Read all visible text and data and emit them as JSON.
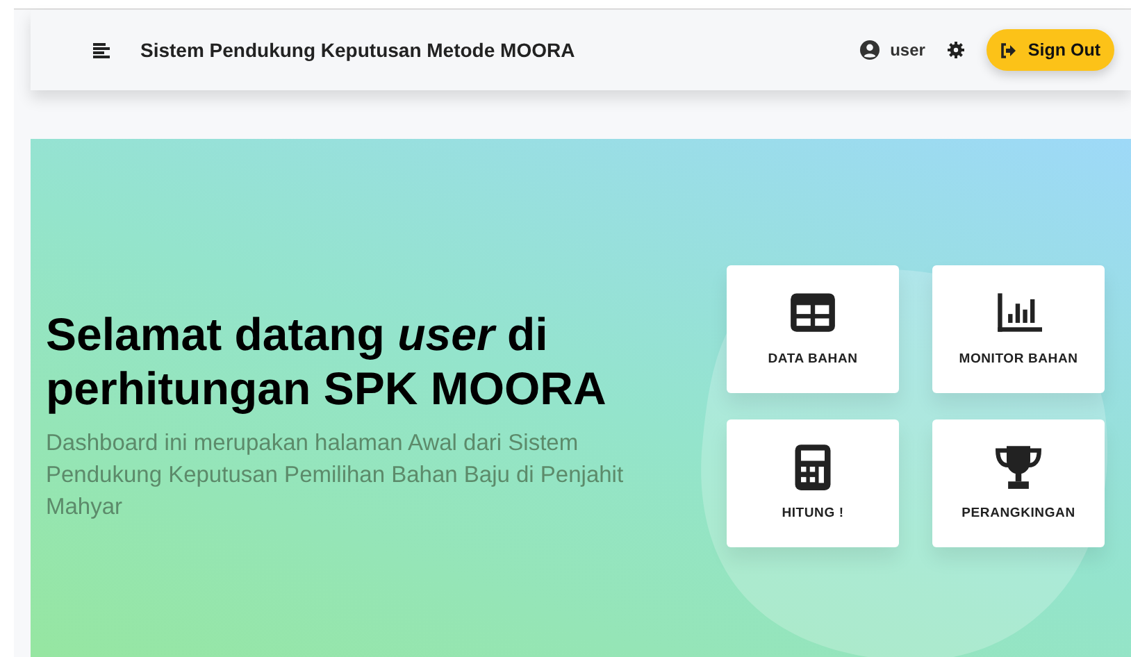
{
  "navbar": {
    "title": "Sistem Pendukung Keputusan Metode MOORA",
    "user": "user",
    "sign_out": "Sign Out"
  },
  "hero": {
    "heading": "Selamat datang *user* di perhitungan SPK MOORA",
    "subtitle": "Dashboard ini merupakan halaman Awal dari Sistem Pendukung Keputusan Pemilihan Bahan Baju di Penjahit Mahyar"
  },
  "tiles": [
    {
      "kind": "table",
      "label": "DATA BAHAN"
    },
    {
      "kind": "chart",
      "label": "MONITOR BAHAN"
    },
    {
      "kind": "calculator",
      "label": "HITUNG !"
    },
    {
      "kind": "trophy",
      "label": "PERANGKINGAN"
    }
  ]
}
